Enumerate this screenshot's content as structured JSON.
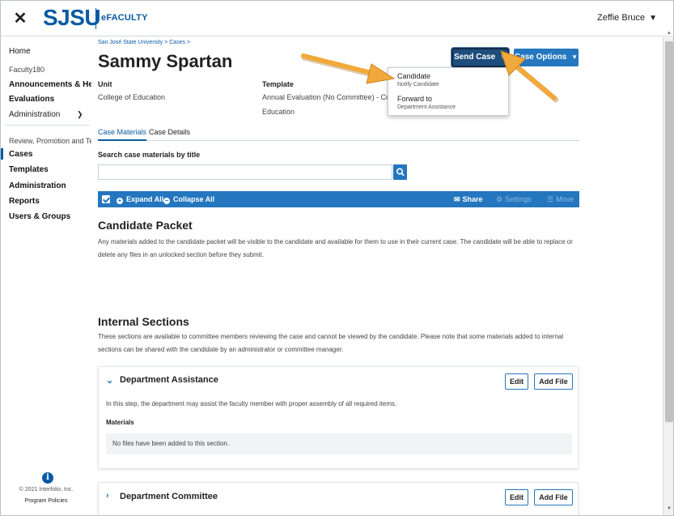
{
  "topbar": {
    "close_icon": "close-icon",
    "logo_text": "SJSU",
    "brand_text": "eFACULTY",
    "user_name": "Zeffie Bruce"
  },
  "sidebar": {
    "home": "Home",
    "section_faculty": "Faculty180",
    "announcements": "Announcements & Help",
    "evaluations": "Evaluations",
    "administration": "Administration",
    "section_rpt": "Review, Promotion and Tenure",
    "cases": "Cases",
    "templates": "Templates",
    "administration2": "Administration",
    "reports": "Reports",
    "users_groups": "Users & Groups",
    "copyright": "© 2021 Interfolio, Inc.",
    "policies": "Program Policies"
  },
  "main": {
    "breadcrumb": "San José State University  >  Cases  >",
    "title": "Sammy Spartan",
    "send_case_label": "Send Case",
    "case_options_label": "Case Options",
    "unit_label": "Unit",
    "unit_value": "College of Education",
    "template_label": "Template",
    "template_value_line1": "Annual Evaluation (No Committee) - College of",
    "template_value_line2": "Education",
    "dropdown": {
      "item1_title": "Candidate",
      "item1_sub": "Notify Candidate",
      "item2_title": "Forward to",
      "item2_sub": "Department Assistance"
    },
    "tabs": [
      "Case Materials",
      "Case Details"
    ],
    "search_label": "Search case materials by title",
    "search_placeholder": "",
    "toolbar": {
      "expand_all": "Expand All",
      "collapse_all": "Collapse All",
      "share": "Share",
      "settings": "Settings",
      "move": "Move"
    },
    "candidate_packet_title": "Candidate Packet",
    "candidate_packet_text": "Any materials added to the candidate packet will be visible to the candidate and available for them to use in their current case. The candidate will be able to replace or delete any files in an unlocked section before they submit.",
    "internal_title": "Internal Sections",
    "internal_text": "These sections are available to committee members reviewing the case and cannot be viewed by the candidate. Please note that some materials added to internal sections can be shared with the candidate by an administrator or committee manager.",
    "sections": [
      {
        "title": "Department Assistance",
        "edit_label": "Edit",
        "add_label": "Add File",
        "description": "In this step, the department may assist the faculty member with proper assembly of all required items.",
        "materials_label": "Materials",
        "empty_text": "No files have been added to this section."
      },
      {
        "title": "Department Committee",
        "edit_label": "Edit",
        "add_label": "Add File"
      }
    ]
  },
  "colors": {
    "brand_blue": "#0b5ba3",
    "button_blue": "#2476bf",
    "send_case_navy": "#1d4d7c",
    "annotation_arrow": "#f2a93b"
  }
}
